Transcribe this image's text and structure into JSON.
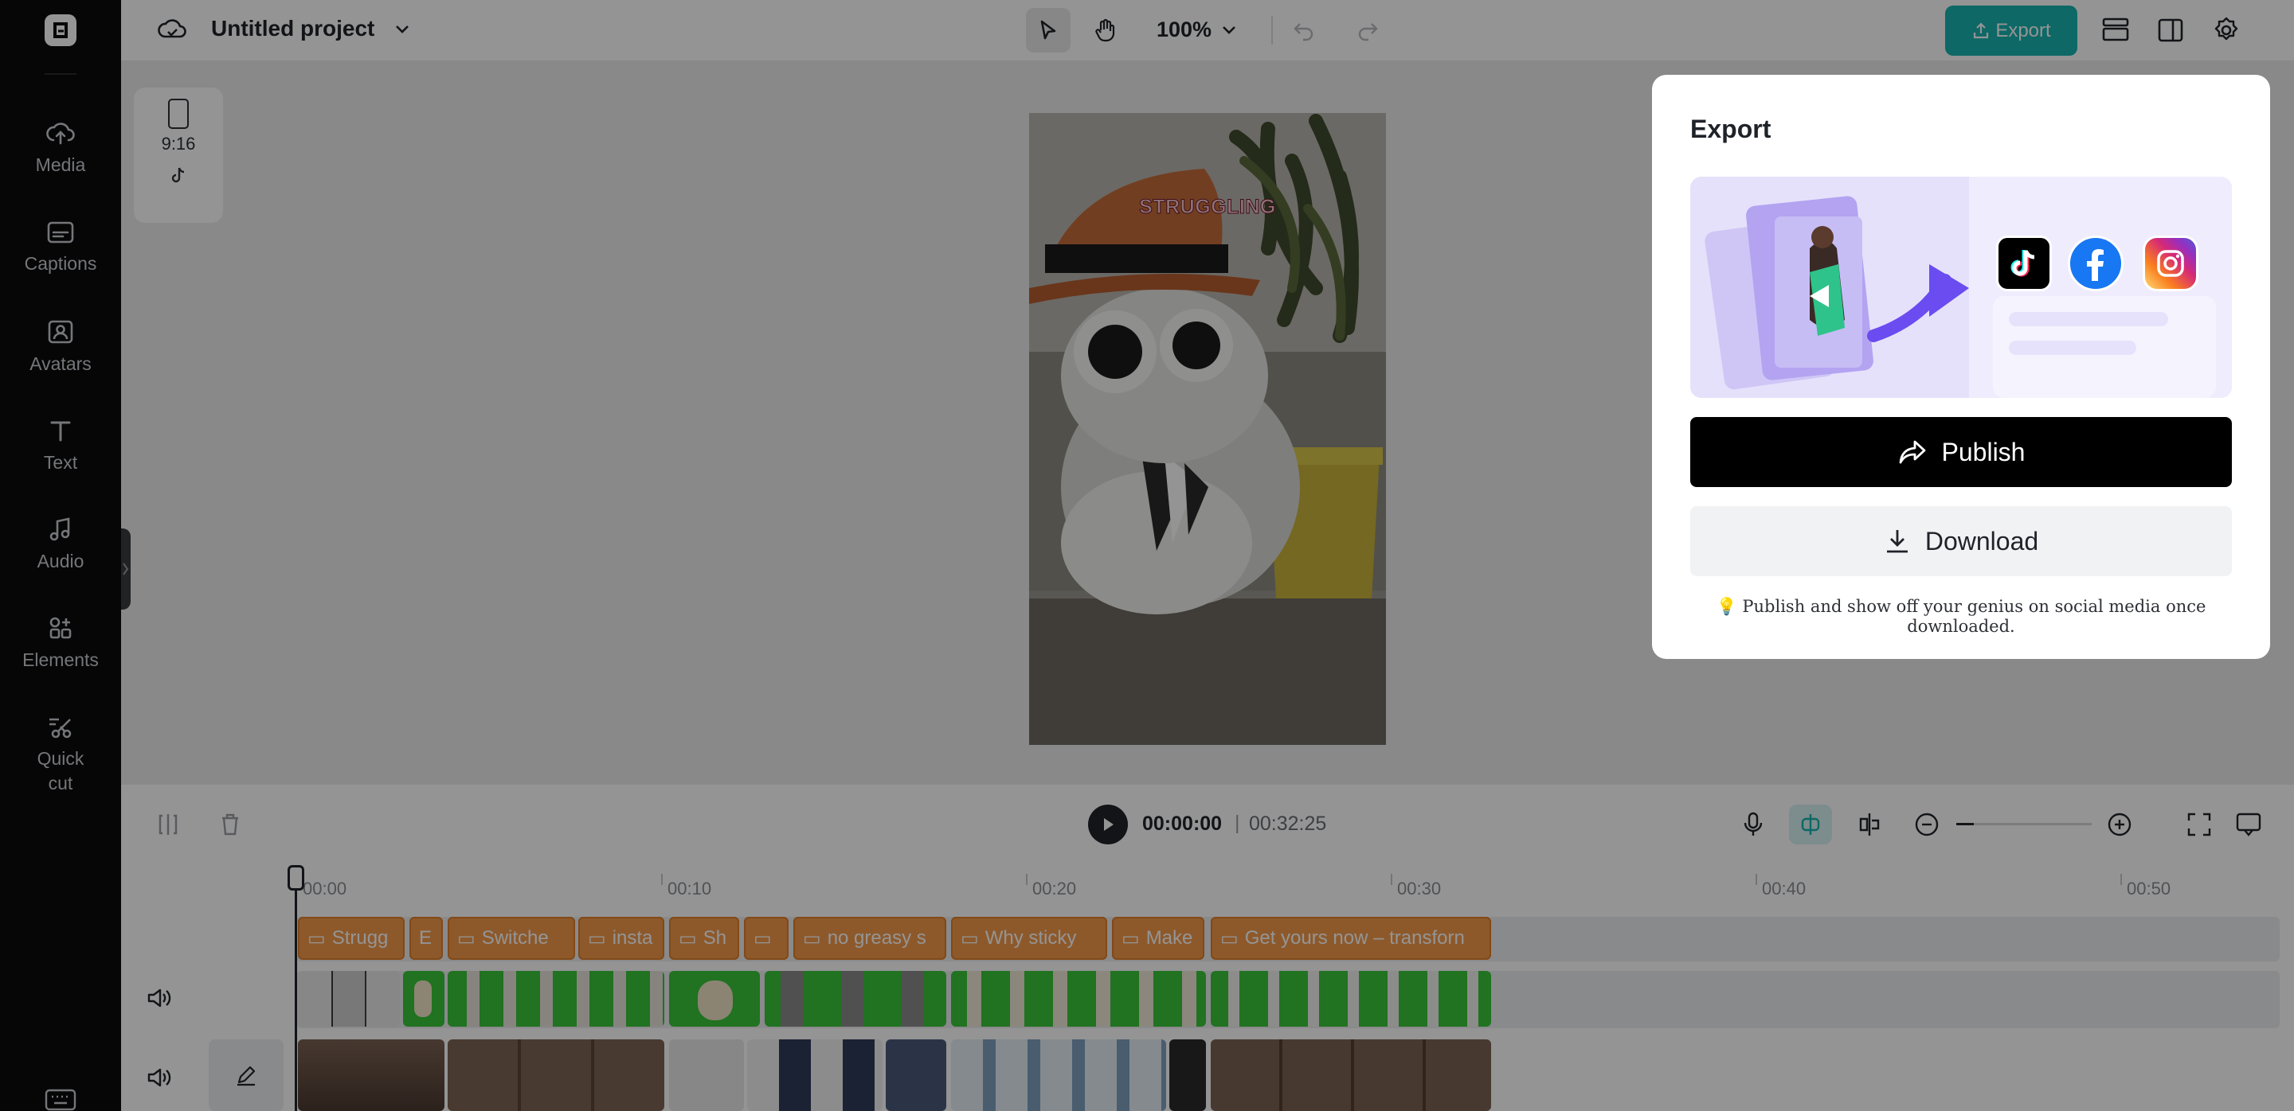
{
  "app": {
    "project_title": "Untitled project",
    "zoom": "100%",
    "export_label": "Export"
  },
  "sidebar": {
    "items": [
      {
        "label": "Media",
        "icon": "cloud-upload-icon"
      },
      {
        "label": "Captions",
        "icon": "captions-icon"
      },
      {
        "label": "Avatars",
        "icon": "avatar-icon"
      },
      {
        "label": "Text",
        "icon": "text-icon"
      },
      {
        "label": "Audio",
        "icon": "music-note-icon"
      },
      {
        "label": "Elements",
        "icon": "elements-grid-icon"
      },
      {
        "label": "Quick\ncut",
        "icon": "scissors-icon"
      }
    ]
  },
  "canvas": {
    "aspect_ratio": "9:16",
    "caption_word": "STRUGGLING"
  },
  "timeline": {
    "current_time": "00:00:00",
    "separator": "|",
    "total_time": "00:32:25",
    "ruler": [
      "00:00",
      "00:10",
      "00:20",
      "00:30",
      "00:40",
      "00:50"
    ],
    "caption_clips": [
      "Strugg",
      "E",
      "Switche",
      "insta",
      "Sh",
      "",
      "no greasy s",
      "Why sticky",
      "Make",
      "Get yours now – transforn"
    ]
  },
  "export_panel": {
    "title": "Export",
    "publish_label": "Publish",
    "download_label": "Download",
    "tip": "💡 Publish and show off your genius on social media once downloaded.",
    "platforms": [
      "tiktok-icon",
      "facebook-icon",
      "instagram-icon"
    ]
  },
  "colors": {
    "accent": "#17b3b0",
    "caption_clip": "#f39a4b",
    "green_screen": "#39c43a",
    "publish_bg": "#000000"
  }
}
